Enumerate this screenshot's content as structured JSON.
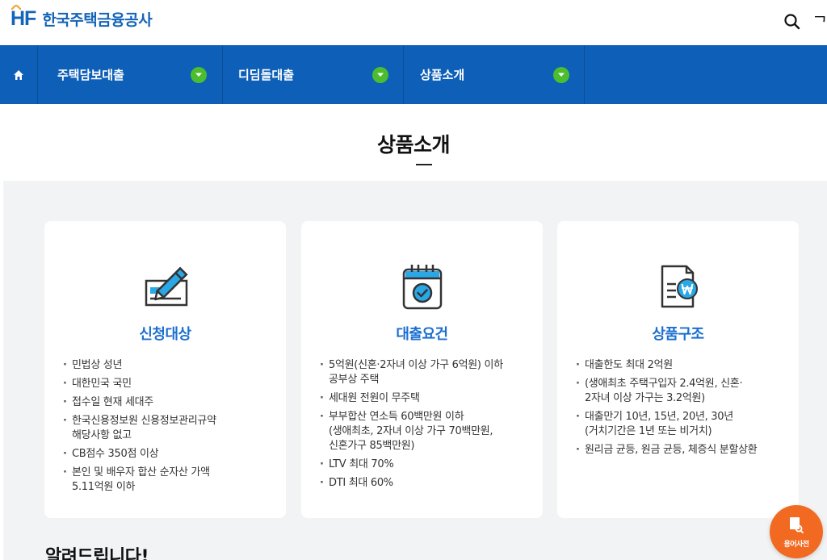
{
  "header": {
    "logo_mark": "HF",
    "logo_text": "한국주택금융공사",
    "partial_text": "ᄀ"
  },
  "nav": {
    "items": [
      {
        "label": "주택담보대출"
      },
      {
        "label": "디딤돌대출"
      },
      {
        "label": "상품소개"
      }
    ],
    "colors": {
      "bar": "#0d5fb7",
      "toggle": "#4bbd2f"
    }
  },
  "page": {
    "title": "상품소개"
  },
  "cards": [
    {
      "icon": "document-pen-icon",
      "title": "신청대상",
      "items": [
        [
          "민법상 성년"
        ],
        [
          "대한민국 국민"
        ],
        [
          "접수일 현재 세대주"
        ],
        [
          "한국신용정보원 신용정보관리규약",
          "해당사항 없고"
        ],
        [
          "CB점수 350점 이상"
        ],
        [
          "본인 및 배우자 합산 순자산 가액",
          "5.11억원 이하"
        ]
      ]
    },
    {
      "icon": "calendar-check-icon",
      "title": "대출요건",
      "items": [
        [
          "5억원(신혼·2자녀 이상 가구 6억원) 이하",
          "공부상 주택"
        ],
        [
          "세대원 전원이 무주택"
        ],
        [
          "부부합산 연소득 60백만원 이하",
          "(생애최초, 2자녀 이상 가구 70백만원,",
          "신혼가구 85백만원)"
        ],
        [
          "LTV 최대 70%"
        ],
        [
          "DTI 최대 60%"
        ]
      ]
    },
    {
      "icon": "document-won-icon",
      "title": "상품구조",
      "items": [
        [
          "대출한도 최대 2억원"
        ],
        [
          "(생애최초 주택구입자 2.4억원, 신혼·",
          "2자녀 이상 가구는 3.2억원)"
        ],
        [
          "대출만기 10년, 15년, 20년, 30년",
          "(거치기간은 1년 또는 비거치)"
        ],
        [
          "원리금 균등, 원금 균등, 체증식 분할상환"
        ]
      ]
    }
  ],
  "notice": {
    "title": "알려드립니다!"
  },
  "glossary": {
    "label": "용어사전"
  }
}
